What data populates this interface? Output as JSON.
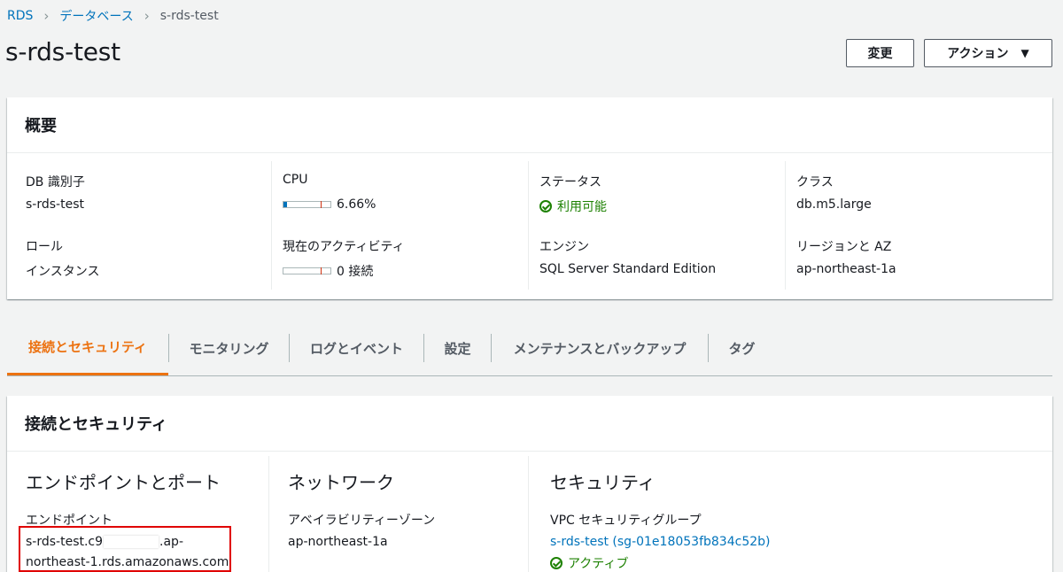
{
  "breadcrumb": {
    "items": [
      "RDS",
      "データベース"
    ],
    "current": "s-rds-test"
  },
  "page_title": "s-rds-test",
  "buttons": {
    "modify": "変更",
    "actions": "アクション"
  },
  "summary": {
    "title": "概要",
    "db_identifier": {
      "label": "DB 識別子",
      "value": "s-rds-test"
    },
    "cpu": {
      "label": "CPU",
      "value": "6.66%",
      "percent": 6.66
    },
    "status": {
      "label": "ステータス",
      "value": "利用可能"
    },
    "class": {
      "label": "クラス",
      "value": "db.m5.large"
    },
    "role": {
      "label": "ロール",
      "value": "インスタンス"
    },
    "activity": {
      "label": "現在のアクティビティ",
      "value": "0 接続",
      "percent": 0
    },
    "engine": {
      "label": "エンジン",
      "value": "SQL Server Standard Edition"
    },
    "region_az": {
      "label": "リージョンと AZ",
      "value": "ap-northeast-1a"
    }
  },
  "tabs": [
    {
      "label": "接続とセキュリティ",
      "active": true
    },
    {
      "label": "モニタリング",
      "active": false
    },
    {
      "label": "ログとイベント",
      "active": false
    },
    {
      "label": "設定",
      "active": false
    },
    {
      "label": "メンテナンスとバックアップ",
      "active": false
    },
    {
      "label": "タグ",
      "active": false
    }
  ],
  "connectivity": {
    "title": "接続とセキュリティ",
    "endpoint_section": {
      "title": "エンドポイントとポート",
      "endpoint_label": "エンドポイント",
      "endpoint_prefix": "s-rds-test.c9",
      "endpoint_suffix": ".ap-",
      "endpoint_line2": "northeast-1.rds.amazonaws.com"
    },
    "network_section": {
      "title": "ネットワーク",
      "az_label": "アベイラビリティーゾーン",
      "az_value": "ap-northeast-1a"
    },
    "security_section": {
      "title": "セキュリティ",
      "sg_label": "VPC セキュリティグループ",
      "sg_value": "s-rds-test (sg-01e18053fb834c52b)",
      "sg_status": "アクティブ"
    }
  },
  "colors": {
    "link": "#0073bb",
    "active_tab": "#ec7211",
    "status_ok": "#1d8102",
    "highlight": "#e00000"
  }
}
